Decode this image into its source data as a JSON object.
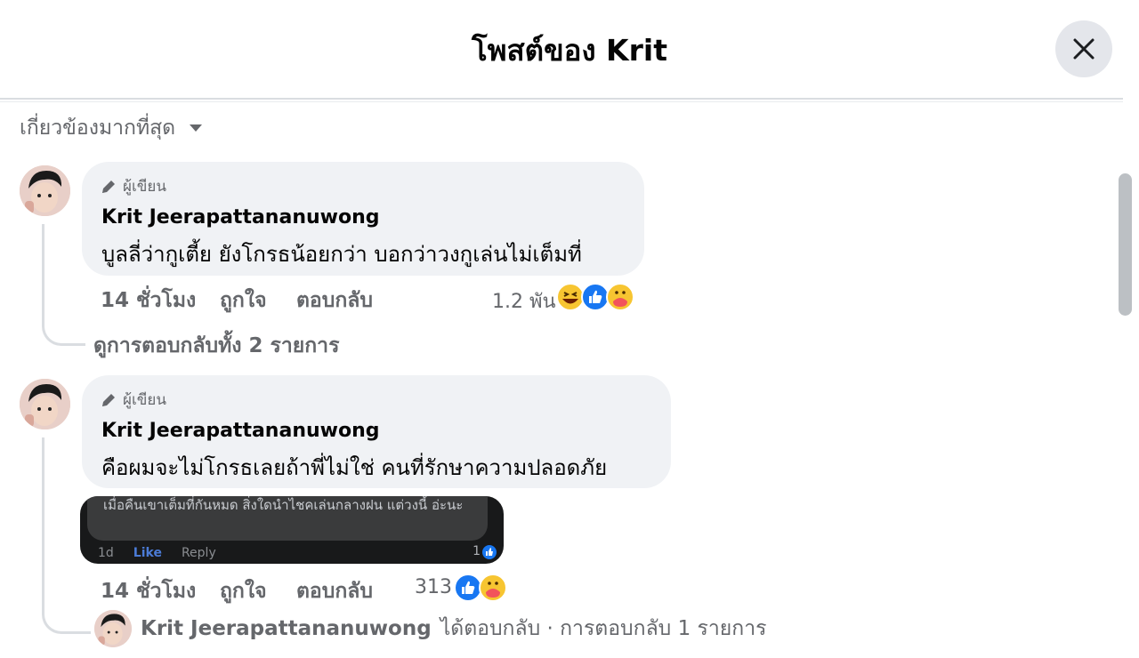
{
  "dialog": {
    "title": "โพสต์ของ Krit",
    "close_label": "×"
  },
  "sort": {
    "label": "เกี่ยวข้องมากที่สุด"
  },
  "comments": [
    {
      "author_badge": "ผู้เขียน",
      "author": "Krit Jeerapattananuwong",
      "text": "บูลลี่ว่ากูเตี้ย ยังโกรธน้อยกว่า บอกว่าวงกูเล่นไม่เต็มที่",
      "time": "14 ชั่วโมง",
      "like": "ถูกใจ",
      "reply": "ตอบกลับ",
      "reaction_count": "1.2 พัน",
      "reactions": [
        "haha",
        "like",
        "care"
      ],
      "view_replies": "ดูการตอบกลับทั้ง 2 รายการ"
    },
    {
      "author_badge": "ผู้เขียน",
      "author": "Krit Jeerapattananuwong",
      "text": "คือผมจะไม่โกรธเลยถ้าพี่ไม่ใช่ คนที่รักษาความปลอดภัย",
      "attachment": {
        "text": "เมื่อคืนเขาเต็มที่กันหมด สิ่งใดนำไชคเล่นกลางฝน แต่วงนี้ อ่ะนะ",
        "age": "1d",
        "like": "Like",
        "reply": "Reply",
        "count": "1"
      },
      "time": "14 ชั่วโมง",
      "like": "ถูกใจ",
      "reply": "ตอบกลับ",
      "reaction_count": "313",
      "reactions": [
        "like",
        "care"
      ],
      "reply_author": "Krit Jeerapattananuwong",
      "reply_summary": "ได้ตอบกลับ · การตอบกลับ 1 รายการ"
    }
  ],
  "colors": {
    "bubble": "#f0f2f5",
    "secondary_text": "#65676b",
    "like_blue": "#1877f2"
  }
}
